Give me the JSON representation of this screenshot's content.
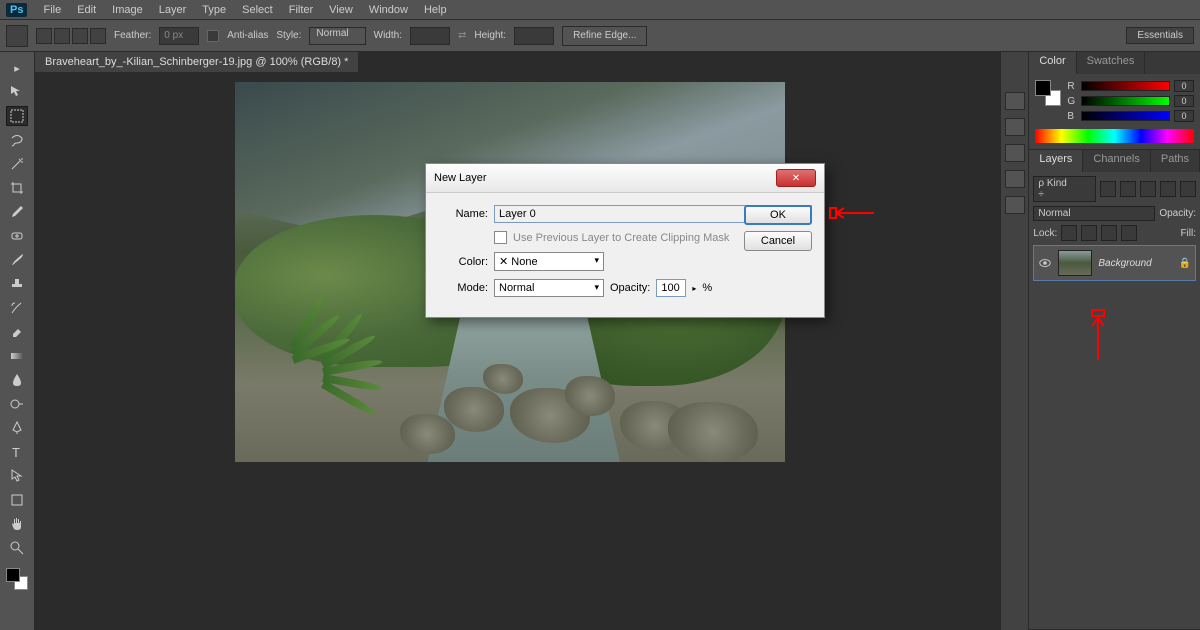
{
  "menu": [
    "File",
    "Edit",
    "Image",
    "Layer",
    "Type",
    "Select",
    "Filter",
    "View",
    "Window",
    "Help"
  ],
  "options": {
    "feather_label": "Feather:",
    "feather_value": "0 px",
    "anti_alias": "Anti-alias",
    "style_label": "Style:",
    "style_value": "Normal",
    "width_label": "Width:",
    "height_label": "Height:",
    "refine_edge": "Refine Edge...",
    "essentials": "Essentials"
  },
  "doc_tab": "Braveheart_by_-Kilian_Schinberger-19.jpg @ 100% (RGB/8) *",
  "color_panel": {
    "tab1": "Color",
    "tab2": "Swatches",
    "r": "R",
    "g": "G",
    "b": "B",
    "val": "0"
  },
  "layers_panel": {
    "tab1": "Layers",
    "tab2": "Channels",
    "tab3": "Paths",
    "kind": "Kind",
    "blend": "Normal",
    "opacity_label": "Opacity:",
    "lock_label": "Lock:",
    "fill_label": "Fill:",
    "layer_name": "Background"
  },
  "dialog": {
    "title": "New Layer",
    "name_label": "Name:",
    "name_value": "Layer 0",
    "clip_label": "Use Previous Layer to Create Clipping Mask",
    "color_label": "Color:",
    "color_value": "None",
    "mode_label": "Mode:",
    "mode_value": "Normal",
    "opacity_label": "Opacity:",
    "opacity_value": "100",
    "percent": "%",
    "ok": "OK",
    "cancel": "Cancel"
  }
}
